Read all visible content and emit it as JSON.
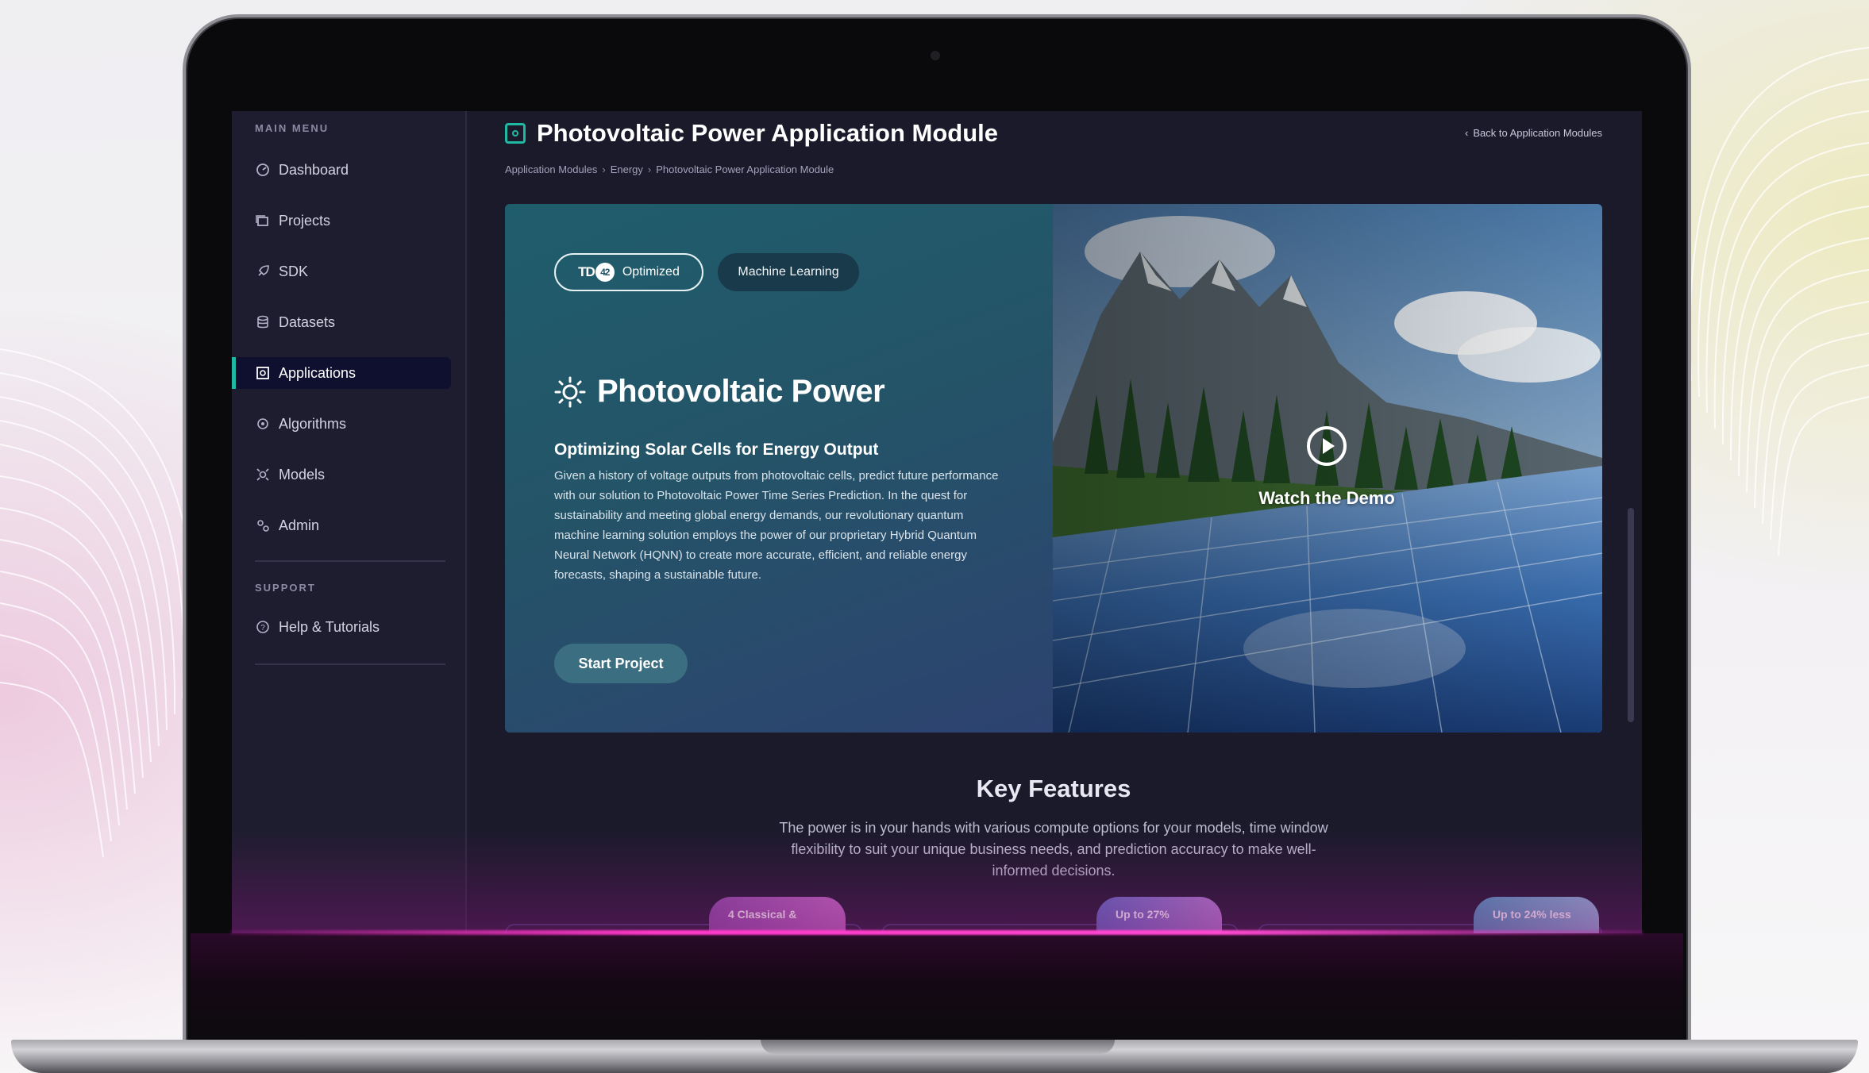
{
  "sidebar": {
    "main_menu_heading": "MAIN MENU",
    "items": [
      {
        "label": "Dashboard",
        "icon": "dashboard-icon"
      },
      {
        "label": "Projects",
        "icon": "projects-icon"
      },
      {
        "label": "SDK",
        "icon": "rocket-icon"
      },
      {
        "label": "Datasets",
        "icon": "database-icon"
      },
      {
        "label": "Applications",
        "icon": "applications-icon",
        "active": true
      },
      {
        "label": "Algorithms",
        "icon": "algorithms-icon"
      },
      {
        "label": "Models",
        "icon": "models-icon"
      },
      {
        "label": "Admin",
        "icon": "admin-icon"
      }
    ],
    "support_heading": "SUPPORT",
    "support_items": [
      {
        "label": "Help & Tutorials",
        "icon": "help-icon"
      }
    ]
  },
  "header": {
    "title": "Photovoltaic Power Application Module",
    "back_link": "Back to Application Modules",
    "breadcrumb": [
      "Application Modules",
      "Energy",
      "Photovoltaic Power Application Module"
    ]
  },
  "hero": {
    "badge_logo": "TD",
    "badge_logo_mark": "42",
    "badge_optimized": "Optimized",
    "badge_ml": "Machine Learning",
    "title": "Photovoltaic Power",
    "subtitle": "Optimizing Solar Cells for Energy Output",
    "description": "Given a history of voltage outputs from photovoltaic cells, predict future performance with our solution to Photovoltaic Power Time Series Prediction. In the quest for sustainability and meeting global energy demands, our revolutionary quantum machine learning solution employs the power of our proprietary Hybrid Quantum Neural Network (HQNN) to create more accurate, efficient, and reliable energy forecasts, shaping a sustainable future.",
    "start_button": "Start Project",
    "demo_label": "Watch the Demo"
  },
  "key_features": {
    "title": "Key Features",
    "description": "The power is in your hands with various compute options for your models, time window flexibility to suit your unique business needs, and prediction accuracy to make well-informed decisions.",
    "tags": [
      "4 Classical &",
      "Up to 27%",
      "Up to 24% less"
    ]
  },
  "colors": {
    "accent": "#1fb9a3",
    "screen_bg": "#1b1a2b",
    "sidebar_active_bg": "#0f1030"
  }
}
